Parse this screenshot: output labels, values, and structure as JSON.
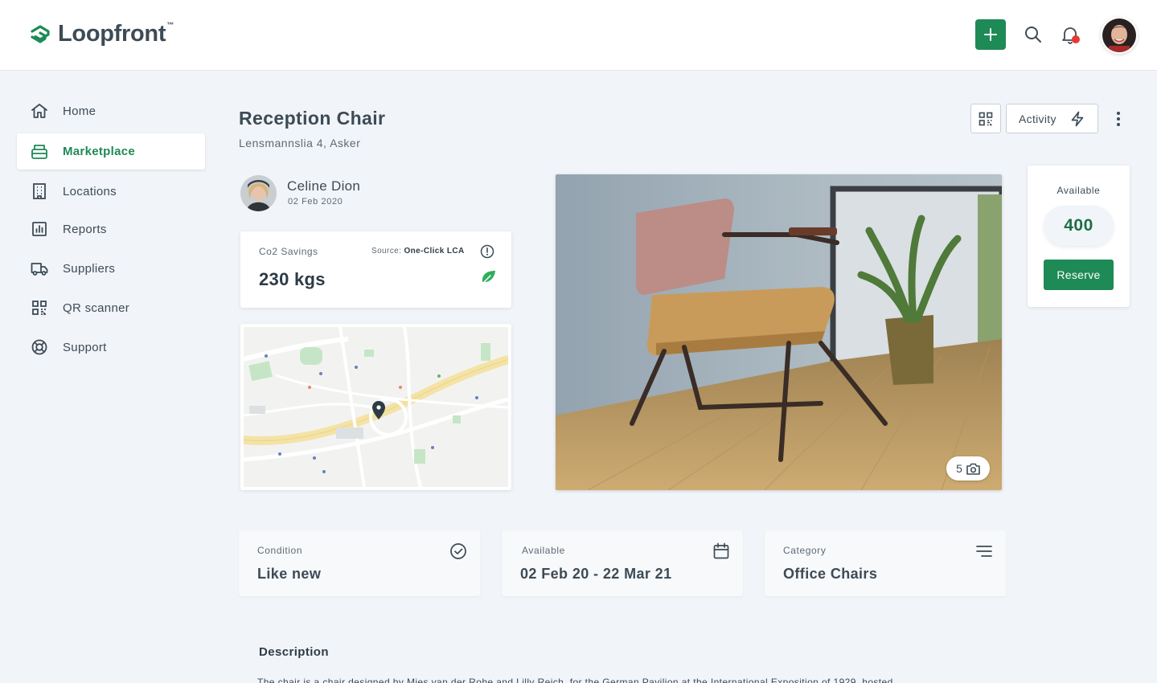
{
  "header": {
    "brand": "Loopfront",
    "brand_tm": "™",
    "brand_color": "#1e8a55",
    "add_icon": "plus-icon",
    "search_icon": "search-icon",
    "notification_icon": "bell-icon",
    "notification_dot_color": "#e53935"
  },
  "sidebar": {
    "items": [
      {
        "label": "Home",
        "icon": "home-icon",
        "active": false
      },
      {
        "label": "Marketplace",
        "icon": "marketplace-icon",
        "active": true
      },
      {
        "label": "Locations",
        "icon": "building-icon",
        "active": false
      },
      {
        "label": "Reports",
        "icon": "reports-icon",
        "active": false
      },
      {
        "label": "Suppliers",
        "icon": "truck-icon",
        "active": false
      },
      {
        "label": "QR scanner",
        "icon": "qr-icon",
        "active": false
      },
      {
        "label": "Support",
        "icon": "lifebuoy-icon",
        "active": false
      }
    ]
  },
  "product": {
    "title": "Reception Chair",
    "address": "Lensmannslia 4, Asker"
  },
  "actions": {
    "activity_label": "Activity"
  },
  "owner": {
    "name": "Celine Dion",
    "date": "02 Feb 2020"
  },
  "co2": {
    "label": "Co2 Savings",
    "source_prefix": "Source:",
    "source_name": "One-Click LCA",
    "value": "230 kgs"
  },
  "photo": {
    "count": "5"
  },
  "availability": {
    "label": "Available",
    "count": "400",
    "reserve_label": "Reserve"
  },
  "info": {
    "condition_label": "Condition",
    "condition_value": "Like new",
    "available_label": "Available",
    "available_value": "02 Feb 20 - 22 Mar 21",
    "category_label": "Category",
    "category_value": "Office Chairs"
  },
  "description": {
    "title": "Description",
    "text": "The  chair is a chair designed by Mies van der Rohe and Lilly Reich, for the German Pavilion at the International Exposition of 1929, hosted"
  }
}
